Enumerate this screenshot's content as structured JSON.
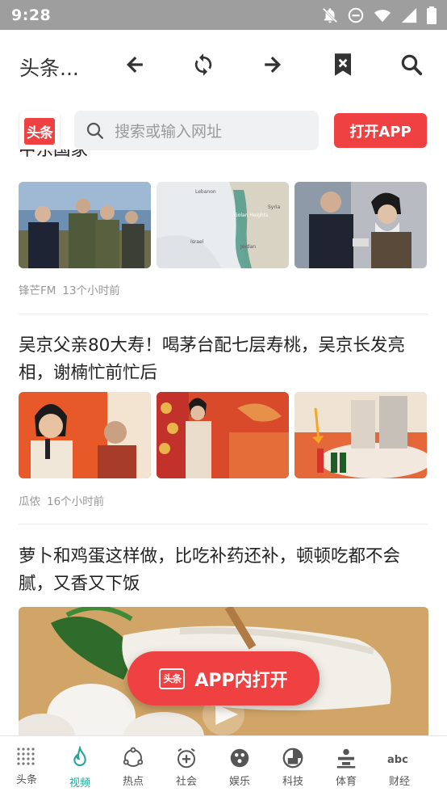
{
  "status_bar": {
    "time": "9:28",
    "icons": [
      "notifications-off-icon",
      "do-not-disturb-icon",
      "wifi-icon",
      "signal-icon",
      "battery-icon"
    ]
  },
  "browser": {
    "title": "头条...",
    "back_icon": "arrow-left-icon",
    "reload_icon": "refresh-icon",
    "forward_icon": "arrow-right-icon",
    "bookmark_icon": "bookmark-close-icon",
    "search_icon": "search-icon"
  },
  "header": {
    "logo_text": "头条",
    "search_placeholder": "搜索或输入网址",
    "open_app_label": "打开APP"
  },
  "feed": {
    "articles": [
      {
        "title": "中东国家",
        "source": "锋芒FM",
        "time": "13个小时前"
      },
      {
        "title": "吴京父亲80大寿！喝茅台配七层寿桃，吴京长发亮相，谢楠忙前忙后",
        "source": "瓜侬",
        "time": "16个小时前"
      },
      {
        "title": "萝卜和鸡蛋这样做，比吃补药还补，顿顿吃都不会腻，又香又下饭"
      }
    ],
    "map_labels": [
      "Lebanon",
      "Golan Heights",
      "Syria",
      "Israel",
      "Jordan"
    ]
  },
  "floating_button": {
    "logo_text": "头条",
    "label": "APP内打开"
  },
  "tabbar": {
    "tabs": [
      {
        "label": "头条",
        "icon": "grid-dots-icon"
      },
      {
        "label": "视频",
        "icon": "flame-icon",
        "active": true
      },
      {
        "label": "热点",
        "icon": "hotspot-icon"
      },
      {
        "label": "社会",
        "icon": "society-icon"
      },
      {
        "label": "娱乐",
        "icon": "entertainment-icon"
      },
      {
        "label": "科技",
        "icon": "tech-icon"
      },
      {
        "label": "体育",
        "icon": "sports-icon"
      },
      {
        "label": "财经",
        "icon": "finance-icon"
      }
    ]
  },
  "colors": {
    "brand_red": "#f04142",
    "active_tab": "#26a69a",
    "status_bar": "#9e9e9e"
  }
}
